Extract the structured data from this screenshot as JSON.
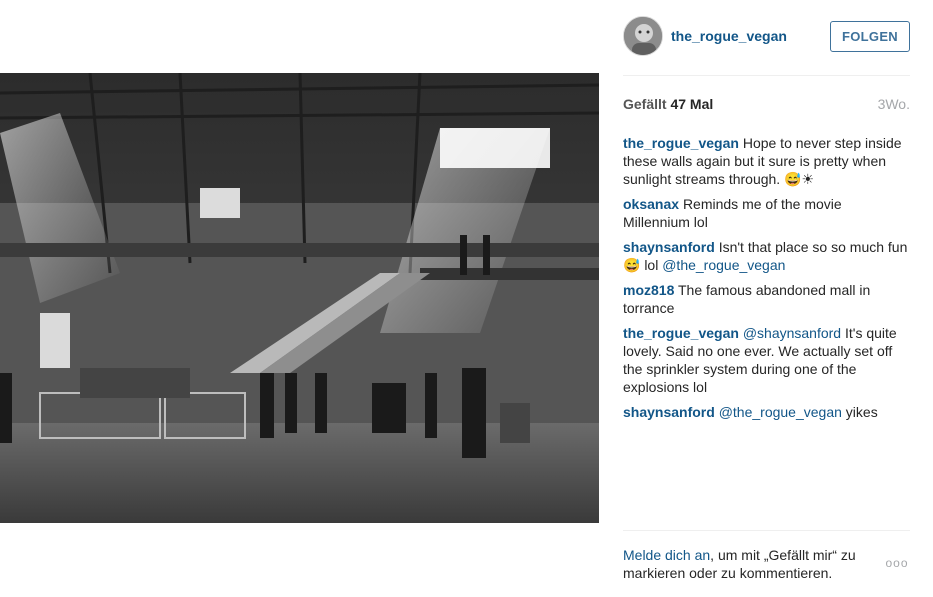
{
  "post": {
    "photo_icon": "photo-abandoned-mall",
    "author": {
      "username": "the_rogue_vegan",
      "avatar_icon": "avatar-image"
    },
    "follow_label": "FOLGEN",
    "likes": {
      "label": "Gefällt",
      "count_text": "47 Mal"
    },
    "age": "3Wo.",
    "comments": [
      {
        "user": "the_rogue_vegan",
        "text": "Hope to never step inside these walls again but it sure is pretty when sunlight streams through. 😅☀"
      },
      {
        "user": "oksanax",
        "text": "Reminds me of the movie Millennium lol"
      },
      {
        "user": "shaynsanford",
        "text": "Isn't that place so so much fun 😅 lol",
        "mention": "@the_rogue_vegan"
      },
      {
        "user": "moz818",
        "text": "The famous abandoned mall in torrance"
      },
      {
        "user": "the_rogue_vegan",
        "mention": "@shaynsanford",
        "text": "It's quite lovely. Said no one ever. We actually set off the sprinkler system during one of the explosions lol"
      },
      {
        "user": "shaynsanford",
        "mention": "@the_rogue_vegan",
        "text": "yikes"
      }
    ],
    "login_prompt": {
      "link": "Melde dich an",
      "rest": ", um mit „Gefällt mir“ zu markieren oder zu kommentieren."
    },
    "more_label": "ooo"
  },
  "colors": {
    "link": "#125688",
    "follow_border": "#3f729b",
    "muted": "#a5a7aa"
  }
}
